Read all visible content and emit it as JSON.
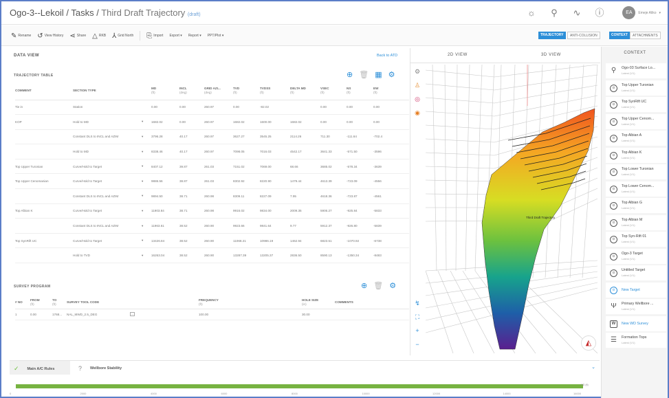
{
  "header": {
    "title": "Ogo-3--Lekoil / Tasks / ",
    "subtitle": "Third Draft Trajectory",
    "badge": "(draft)",
    "user_initials": "EA",
    "user_name": "Emeje Aliko"
  },
  "toolbar": {
    "items": [
      "Rename",
      "View History",
      "Share",
      "RKB",
      "Grid North",
      "Import",
      "Export ▾",
      "Report ▾",
      "PPT/Plot ▾"
    ],
    "tabs": [
      "TRAJECTORY",
      "ANTI-COLLISION"
    ],
    "right_tabs": [
      "CONTEXT",
      "ATTACHMENTS"
    ]
  },
  "dataview": {
    "title": "DATA VIEW",
    "back_link": "Back to ATD"
  },
  "trajectory": {
    "title": "TRAJECTORY TABLE",
    "headers": [
      {
        "label": "COMMENT",
        "unit": ""
      },
      {
        "label": "SECTION TYPE",
        "unit": ""
      },
      {
        "label": "",
        "unit": ""
      },
      {
        "label": "MD",
        "unit": "(ft)"
      },
      {
        "label": "INCL",
        "unit": "(deg)"
      },
      {
        "label": "GRID AZI...",
        "unit": "(deg)"
      },
      {
        "label": "TVD",
        "unit": "(ft)"
      },
      {
        "label": "TVDSS",
        "unit": "(ft)"
      },
      {
        "label": "DELTA MD",
        "unit": "(ft)"
      },
      {
        "label": "VSEC",
        "unit": "(ft)"
      },
      {
        "label": "NS",
        "unit": "(ft)"
      },
      {
        "label": "EW",
        "unit": "(ft)"
      }
    ],
    "rows": [
      [
        "Tie in",
        "Station",
        "",
        "0.00",
        "0.00",
        "260.97",
        "0.00",
        "-82.02",
        "",
        "0.00",
        "0.00",
        "0.00"
      ],
      [
        "KOP",
        "Hold to MD",
        "▾",
        "1682.02",
        "0.00",
        "260.97",
        "1682.02",
        "1600.00",
        "1682.02",
        "0.00",
        "0.00",
        "0.00"
      ],
      [
        "",
        "Constant DLS to INCL and AZIM",
        "▾",
        "3796.28",
        "40.17",
        "260.97",
        "3627.27",
        "3545.25",
        "2114.26",
        "711.30",
        "-111.64",
        "-702.4"
      ],
      [
        "",
        "Hold to MD",
        "▾",
        "8338.46",
        "40.17",
        "260.97",
        "7098.05",
        "7016.03",
        "4542.17",
        "3641.33",
        "-571.50",
        "-3596"
      ],
      [
        "Top Upper Turonian",
        "Curve/Hold to Target",
        "▾",
        "8407.12",
        "39.87",
        "261.03",
        "7151.02",
        "7069.00",
        "68.66",
        "3685.02",
        "-578.34",
        "-3639"
      ],
      [
        "Top Upper Cenomanian",
        "Curve/Hold to Target",
        "▾",
        "9886.56",
        "38.87",
        "261.03",
        "8302.92",
        "8220.90",
        "1479.44",
        "4613.39",
        "-723.09",
        "-4556"
      ],
      [
        "",
        "Constant DLS to INCL and AZIM",
        "▾",
        "9894.50",
        "38.71",
        "260.98",
        "8309.11",
        "8227.09",
        "7.95",
        "4618.36",
        "-723.87",
        "-4561"
      ],
      [
        "Top Albian K",
        "Curve/Hold to Target",
        "▾",
        "11903.84",
        "38.71",
        "260.98",
        "9916.02",
        "9834.00",
        "2009.35",
        "5906.27",
        "-925.84",
        "-5833"
      ],
      [
        "",
        "Constant DLS to INCL and AZIM",
        "▾",
        "11963.61",
        "38.52",
        "260.90",
        "9923.66",
        "9841.64",
        "9.77",
        "5912.37",
        "-926.80",
        "-5839"
      ],
      [
        "Top SynRift UC",
        "Curve/Hold to Target",
        "▾",
        "13426.84",
        "38.52",
        "260.90",
        "11068.21",
        "10986.19",
        "1462.94",
        "6823.51",
        "-1070.92",
        "-6738"
      ],
      [
        "",
        "Hold to TVD",
        "▾",
        "16263.04",
        "38.52",
        "260.90",
        "13287.39",
        "13205.37",
        "2836.50",
        "8590.13",
        "-1350.34",
        "-8483"
      ]
    ]
  },
  "survey": {
    "title": "SURVEY PROGRAM",
    "headers": [
      {
        "label": "# NO",
        "unit": ""
      },
      {
        "label": "FROM",
        "unit": "(ft)"
      },
      {
        "label": "TO",
        "unit": "(ft)"
      },
      {
        "label": "SURVEY TOOL CODE",
        "unit": ""
      },
      {
        "label": "",
        "unit": ""
      },
      {
        "label": "FREQUENCY",
        "unit": "(ft)"
      },
      {
        "label": "HOLE SIZE",
        "unit": "(in)"
      },
      {
        "label": "COMMENTS",
        "unit": ""
      }
    ],
    "rows": [
      [
        "1",
        "0.00",
        "1768...",
        "NAL_MWD_2.5_DEG",
        "…",
        "100.00",
        "30.00",
        ""
      ]
    ]
  },
  "view": {
    "tabs": [
      "2D VIEW",
      "3D VIEW"
    ],
    "label": "Third Draft Trajectory"
  },
  "context": {
    "title": "CONTEXT",
    "items": [
      {
        "name": "Ogo-03 Surface Lo...",
        "sub": "Latest (V1)",
        "icon": "pin-icon",
        "new": false
      },
      {
        "name": "Top Upper Turonian",
        "sub": "Latest (V1)",
        "icon": "target-icon",
        "new": false
      },
      {
        "name": "Top SynRift UC",
        "sub": "Latest (V1)",
        "icon": "target-icon",
        "new": false
      },
      {
        "name": "Top Upper Cenom...",
        "sub": "Latest (V1)",
        "icon": "target-icon",
        "new": false
      },
      {
        "name": "Top Albian A",
        "sub": "Latest (V1)",
        "icon": "target-icon",
        "new": false
      },
      {
        "name": "Top Albian K",
        "sub": "Latest (V1)",
        "icon": "target-icon",
        "new": false
      },
      {
        "name": "Top Lower Turonian",
        "sub": "Latest (V1)",
        "icon": "target-icon",
        "new": false
      },
      {
        "name": "Top Lower Cenom...",
        "sub": "Latest (V1)",
        "icon": "target-icon",
        "new": false
      },
      {
        "name": "Top Albian G",
        "sub": "Latest (V1)",
        "icon": "target-icon",
        "new": false
      },
      {
        "name": "Top Albian M",
        "sub": "Latest (V1)",
        "icon": "target-icon",
        "new": false
      },
      {
        "name": "Top Syn-Rift 01",
        "sub": "Latest (V1)",
        "icon": "target-icon",
        "new": false
      },
      {
        "name": "Ogo-3 Target",
        "sub": "Latest (V1)",
        "icon": "target-icon",
        "new": false
      },
      {
        "name": "Untitled Target",
        "sub": "Latest (V1)",
        "icon": "target-icon",
        "new": false
      },
      {
        "name": "New Target",
        "sub": "",
        "icon": "target-icon",
        "new": true
      },
      {
        "name": "Primary Wellbore ...",
        "sub": "Latest (V1)",
        "icon": "wellbore-icon",
        "new": false
      },
      {
        "name": "New WD Survey",
        "sub": "",
        "icon": "survey-icon",
        "new": true
      },
      {
        "name": "Formation Tops",
        "sub": "Latest (V1)",
        "icon": "formation-icon",
        "new": false
      }
    ]
  },
  "bottom": {
    "tabs": [
      "Main A/C Rules",
      "Wellbore Stability"
    ],
    "progress_label": "MD (ft)",
    "progress_fraction": 1.0,
    "ticks": [
      "0",
      "2000",
      "4000",
      "6000",
      "8000",
      "10000",
      "12000",
      "14000",
      "16000"
    ]
  },
  "colors": {
    "accent": "#2d8fd8",
    "progress": "#77b341"
  }
}
